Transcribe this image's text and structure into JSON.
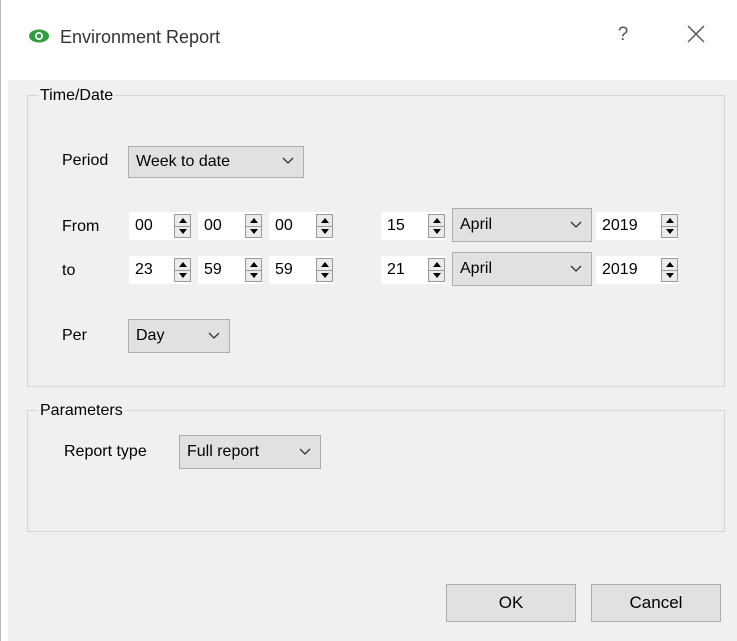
{
  "window": {
    "title": "Environment Report",
    "help_label": "?"
  },
  "time_date": {
    "group_title": "Time/Date",
    "period": {
      "label": "Period",
      "value": "Week to date"
    },
    "from": {
      "label": "From",
      "hour": "00",
      "minute": "00",
      "second": "00",
      "day": "15",
      "month": "April",
      "year": "2019"
    },
    "to": {
      "label": "to",
      "hour": "23",
      "minute": "59",
      "second": "59",
      "day": "21",
      "month": "April",
      "year": "2019"
    },
    "per": {
      "label": "Per",
      "value": "Day"
    }
  },
  "parameters": {
    "group_title": "Parameters",
    "report_type": {
      "label": "Report type",
      "value": "Full report"
    }
  },
  "buttons": {
    "ok": "OK",
    "cancel": "Cancel"
  },
  "colors": {
    "eye_icon": "#2e9e3e"
  }
}
